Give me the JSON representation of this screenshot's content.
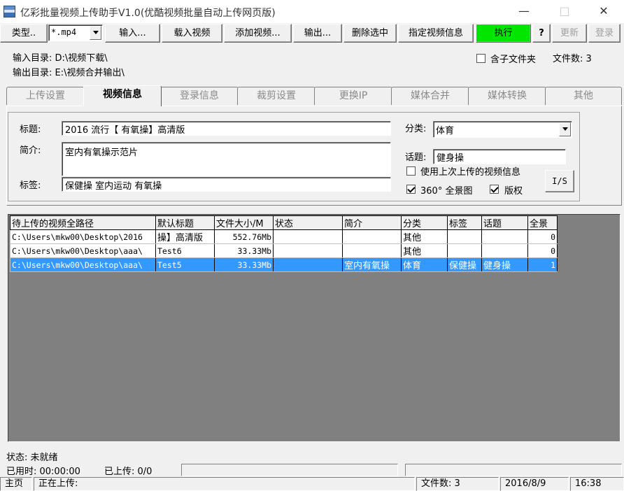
{
  "window": {
    "title": "亿彩批量视频上传助手V1.0(优酷视频批量自动上传网页版)"
  },
  "toolbar": {
    "type_label": "类型..",
    "type_value": "*.mp4",
    "input_label": "输入...",
    "load_label": "载入视频",
    "add_label": "添加视频...",
    "output_label": "输出...",
    "delete_label": "删除选中",
    "assign_label": "指定视频信息",
    "execute_label": "执行",
    "help_label": "?",
    "update_label": "更新",
    "login_label": "登录"
  },
  "dirs": {
    "input": "输入目录: D:\\视频下载\\",
    "output": "输出目录: E:\\视频合并输出\\",
    "subfolder_label": "含子文件夹",
    "file_count": "文件数: 3"
  },
  "tabs": [
    {
      "label": "上传设置"
    },
    {
      "label": "视频信息"
    },
    {
      "label": "登录信息"
    },
    {
      "label": "裁剪设置"
    },
    {
      "label": "更换IP"
    },
    {
      "label": "媒体合并"
    },
    {
      "label": "媒体转换"
    },
    {
      "label": "其他"
    }
  ],
  "form": {
    "title_label": "标题:",
    "title_value": "2016   流行【 有氧操】高清版",
    "intro_label": "简介:",
    "intro_value": "室内有氧操示范片",
    "tags_label": "标签:",
    "tags_value": "保健操 室内运动 有氧操",
    "category_label": "分类:",
    "category_value": "体育",
    "topic_label": "话题:",
    "topic_value": "健身操",
    "use_last_label": "使用上次上传的视频信息",
    "pano_label": "360° 全景图",
    "copyright_label": "版权",
    "io_button": "I/S",
    "colors": {
      "execute": "#00e600",
      "selection": "#3399ff"
    }
  },
  "table": {
    "columns": [
      "待上传的视频全路径",
      "默认标题",
      "文件大小/M",
      "状态",
      "简介",
      "分类",
      "标签",
      "话题",
      "全景"
    ],
    "rows": [
      [
        "C:\\Users\\mkw00\\Desktop\\2016",
        "操】高清版",
        "552.76Mb",
        "",
        "",
        "其他",
        "",
        "",
        "0"
      ],
      [
        "C:\\Users\\mkw00\\Desktop\\aaa\\",
        "Test6",
        "33.33Mb",
        "",
        "",
        "其他",
        "",
        "",
        "0"
      ],
      [
        "C:\\Users\\mkw00\\Desktop\\aaa\\",
        "Test5",
        "33.33Mb",
        "",
        "室内有氧操",
        "体育",
        "保健操",
        "健身操",
        "1"
      ]
    ]
  },
  "status": {
    "state": "状态: 未就绪",
    "elapsed": "已用时: 00:00:00",
    "uploaded": "已上传: 0/0",
    "home": "主页",
    "uploading": "正在上传:",
    "file_count": "文件数: 3",
    "date": "2016/8/9",
    "time": "16:38"
  }
}
